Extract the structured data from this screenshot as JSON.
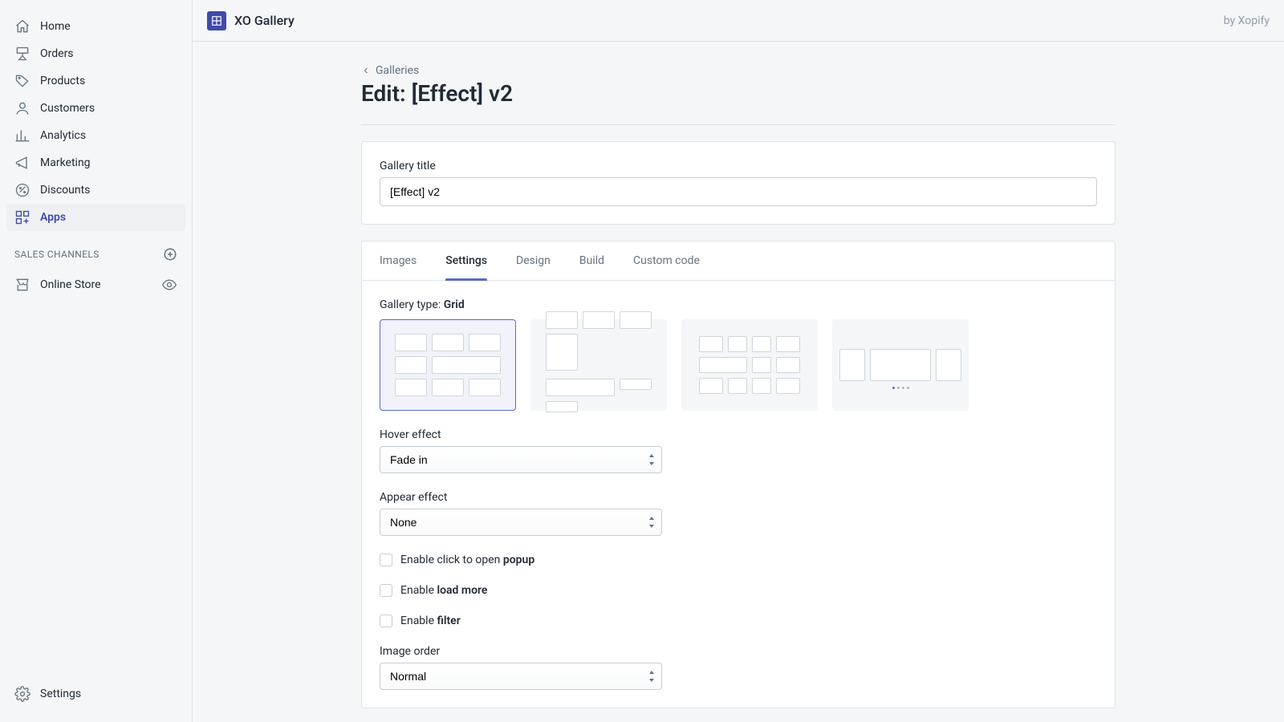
{
  "app": {
    "title": "XO Gallery",
    "by": "by Xopify"
  },
  "sidebar": {
    "items": [
      {
        "label": "Home"
      },
      {
        "label": "Orders"
      },
      {
        "label": "Products"
      },
      {
        "label": "Customers"
      },
      {
        "label": "Analytics"
      },
      {
        "label": "Marketing"
      },
      {
        "label": "Discounts"
      },
      {
        "label": "Apps"
      }
    ],
    "sales_channels_header": "Sales channels",
    "channels": [
      {
        "label": "Online Store"
      }
    ],
    "settingsLabel": "Settings"
  },
  "breadcrumb": {
    "label": "Galleries"
  },
  "page": {
    "title": "Edit: [Effect] v2"
  },
  "titleCard": {
    "label": "Gallery title",
    "value": "[Effect] v2"
  },
  "tabs": {
    "items": [
      {
        "label": "Images"
      },
      {
        "label": "Settings"
      },
      {
        "label": "Design"
      },
      {
        "label": "Build"
      },
      {
        "label": "Custom code"
      }
    ],
    "activeIndex": 1
  },
  "galleryType": {
    "label": "Gallery type:",
    "value": "Grid",
    "options": [
      "Grid",
      "Masonry",
      "Justified",
      "Slider"
    ],
    "selectedIndex": 0
  },
  "hover": {
    "label": "Hover effect",
    "value": "Fade in"
  },
  "appear": {
    "label": "Appear effect",
    "value": "None"
  },
  "checks": {
    "popup_pre": "Enable click to open ",
    "popup_bold": "popup",
    "loadmore_pre": "Enable ",
    "loadmore_bold": "load more",
    "filter_pre": "Enable ",
    "filter_bold": "filter"
  },
  "imageOrder": {
    "label": "Image order",
    "value": "Normal"
  }
}
